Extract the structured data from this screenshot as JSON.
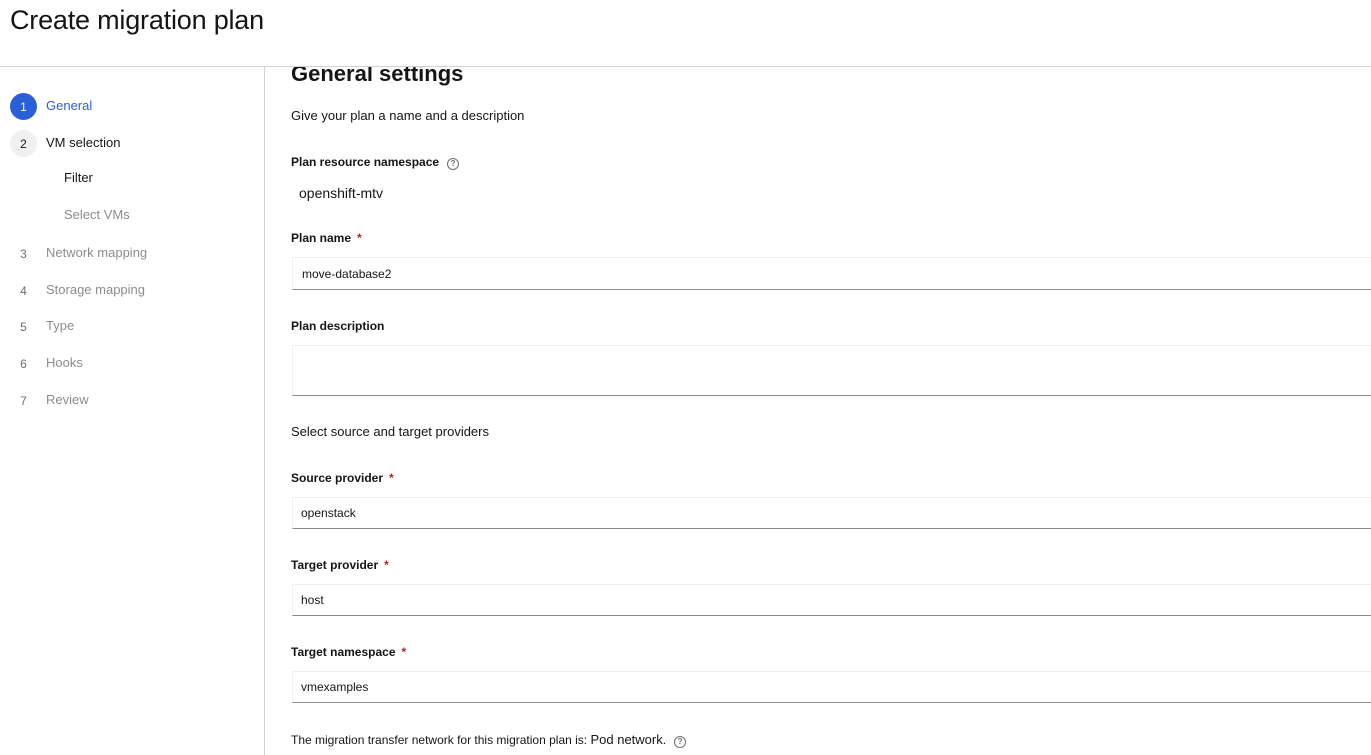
{
  "page": {
    "title": "Create migration plan"
  },
  "wizard": {
    "steps": [
      {
        "num": "1",
        "label": "General"
      },
      {
        "num": "2",
        "label": "VM selection"
      },
      {
        "num": "3",
        "label": "Network mapping"
      },
      {
        "num": "4",
        "label": "Storage mapping"
      },
      {
        "num": "5",
        "label": "Type"
      },
      {
        "num": "6",
        "label": "Hooks"
      },
      {
        "num": "7",
        "label": "Review"
      }
    ],
    "substeps": [
      {
        "label": "Filter"
      },
      {
        "label": "Select VMs"
      }
    ]
  },
  "form": {
    "section_title": "General settings",
    "name_desc_heading": "Give your plan a name and a description",
    "namespace_label": "Plan resource namespace",
    "namespace_value": "openshift-mtv",
    "plan_name_label": "Plan name",
    "plan_name_value": "move-database2",
    "plan_desc_label": "Plan description",
    "plan_desc_value": "",
    "providers_heading": "Select source and target providers",
    "source_label": "Source provider",
    "source_value": "openstack",
    "target_label": "Target provider",
    "target_value": "host",
    "target_ns_label": "Target namespace",
    "target_ns_value": "vmexamples",
    "transfer_prefix": "The migration transfer network for this migration plan is: ",
    "transfer_value": "Pod network",
    "transfer_suffix": ".",
    "required_mark": "*",
    "help_glyph": "?"
  },
  "colors": {
    "accent": "#2b5fd9",
    "required": "#c9190b",
    "border": "#d2d2d2"
  }
}
